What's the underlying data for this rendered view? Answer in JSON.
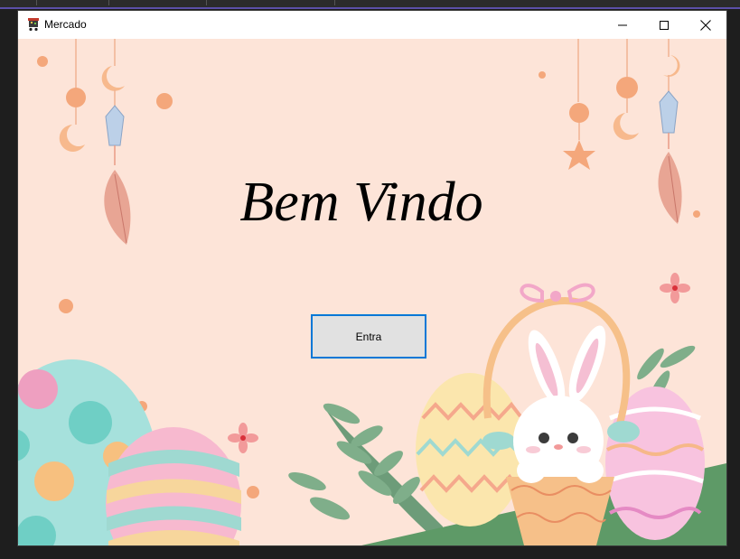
{
  "window": {
    "title": "Mercado",
    "icon": "shopping-cart-icon",
    "controls": [
      "minimize-icon",
      "maximize-icon",
      "close-icon"
    ]
  },
  "main": {
    "welcome_text": "Bem Vindo",
    "enter_button_label": "Entra"
  },
  "colors": {
    "background": "#fde4d8",
    "button_face": "#e1e1e1",
    "button_focus_border": "#0078d7"
  }
}
